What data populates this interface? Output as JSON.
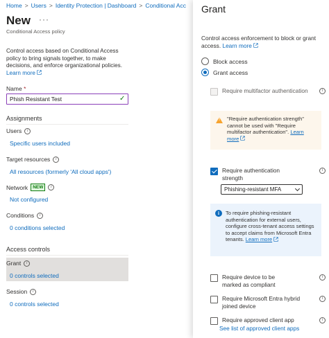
{
  "breadcrumb": [
    "Home",
    "Users",
    "Identity Protection | Dashboard",
    "Conditional Acc"
  ],
  "header": {
    "title": "New",
    "more_icon": "ellipsis-icon",
    "subtitle": "Conditional Access policy"
  },
  "description": {
    "text": "Control access based on Conditional Access policy to bring signals together, to make decisions, and enforce organizational policies.",
    "link": "Learn more"
  },
  "name_field": {
    "label": "Name",
    "required_mark": "*",
    "value": "Phish Resistant Test"
  },
  "assignments": {
    "title": "Assignments",
    "users": {
      "label": "Users",
      "value": "Specific users included"
    },
    "target_resources": {
      "label": "Target resources",
      "value": "All resources (formerly 'All cloud apps')"
    },
    "network": {
      "label": "Network",
      "badge": "NEW",
      "value": "Not configured"
    },
    "conditions": {
      "label": "Conditions",
      "value": "0 conditions selected"
    }
  },
  "access_controls": {
    "title": "Access controls",
    "grant": {
      "label": "Grant",
      "value": "0 controls selected"
    },
    "session": {
      "label": "Session",
      "value": "0 controls selected"
    }
  },
  "grant_panel": {
    "title": "Grant",
    "description": "Control access enforcement to block or grant access.",
    "learn_more": "Learn more",
    "block_access": "Block access",
    "grant_access": "Grant access",
    "selected_option": "Grant access",
    "require_mfa": "Require multifactor authentication",
    "warning": {
      "text": "\"Require authentication strength\" cannot be used with \"Require multifactor authentication\".",
      "link": "Learn more"
    },
    "require_auth_strength": "Require authentication strength",
    "auth_strength_value": "Phishing-resistant MFA",
    "info": {
      "text": "To require phishing-resistant authentication for external users, configure cross-tenant access settings to accept claims from Microsoft Entra tenants.",
      "link": "Learn more"
    },
    "require_compliant": "Require device to be marked as compliant",
    "require_hybrid": "Require Microsoft Entra hybrid joined device",
    "require_approved_app": "Require approved client app",
    "approved_apps_link": "See list of approved client apps"
  },
  "colors": {
    "accent": "#0f6cbd",
    "warning_bg": "#fdf6ec",
    "info_bg": "#ebf3fc",
    "selected_row": "#e1dfdd",
    "new_badge": "#107c10",
    "input_border": "#8a3fb8"
  }
}
